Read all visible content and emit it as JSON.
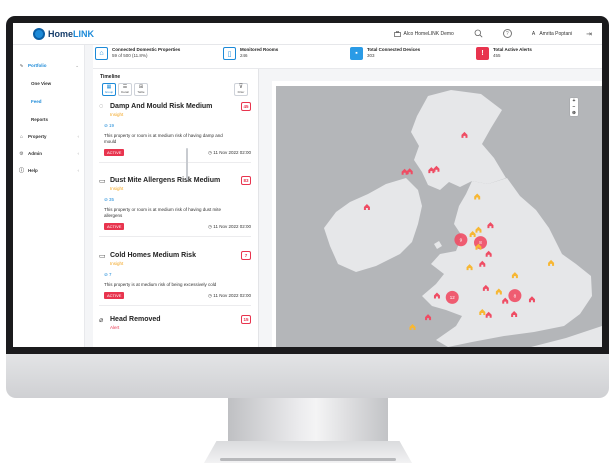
{
  "app": {
    "logo_home": "Home",
    "logo_link": "LINK",
    "demo_name": "Alco HomeLINK Demo",
    "help_glyph": "?",
    "user_initial": "A",
    "user_name": "Amrita Poptani"
  },
  "sidebar": {
    "portfolio": "Portfolio",
    "one_view": "One View",
    "feed": "Feed",
    "reports": "Reports",
    "property": "Property",
    "admin": "Admin",
    "help": "Help"
  },
  "stats": [
    {
      "title": "Connected Domestic Properties",
      "value": "59 of 500 (11.8%)",
      "color": "#1c8ad8"
    },
    {
      "title": "Monitored Rooms",
      "value": "246",
      "color": "#1c8ad8"
    },
    {
      "title": "Total Connected Devices",
      "value": "303",
      "color": "#2a9be6"
    },
    {
      "title": "Total Active Alerts",
      "value": "455",
      "color": "#e8344e"
    }
  ],
  "timeline": {
    "title": "Timeline",
    "views": [
      "Group",
      "Detail",
      "Table"
    ],
    "filter_label": "Filter",
    "cards": [
      {
        "title": "Damp And Mould Risk Medium",
        "type": "Insight",
        "count": "45",
        "link": "19",
        "desc": "This property or room is at medium risk of having damp and mould",
        "status": "ACTIVE",
        "date": "11 Nov 2022 02:00"
      },
      {
        "title": "Dust Mite Allergens Risk Medium",
        "type": "Insight",
        "count": "83",
        "link": "35",
        "desc": "This property or room is at medium risk of having dust mite allergens",
        "status": "ACTIVE",
        "date": "11 Nov 2022 02:00"
      },
      {
        "title": "Cold Homes Medium Risk",
        "type": "Insight",
        "count": "7",
        "link": "7",
        "desc": "This property is at medium risk of being excessively cold",
        "status": "ACTIVE",
        "date": "11 Nov 2022 02:00"
      },
      {
        "title": "Head Removed",
        "type": "Alert",
        "count": "15"
      }
    ]
  },
  "map": {
    "zoom_in": "+",
    "zoom_out": "−",
    "reset": "⊕",
    "colors": {
      "land": "#e6e7e9",
      "sea": "#b4b6b9",
      "red_marker": "#ef4d64",
      "amber_marker": "#f7b733"
    },
    "markers": [
      {
        "kind": "red",
        "lon": -2.1,
        "lat": 57.14
      },
      {
        "kind": "red",
        "lon": -3.2,
        "lat": 55.95
      },
      {
        "kind": "red",
        "lon": -3.4,
        "lat": 55.9
      },
      {
        "kind": "red",
        "lon": -4.25,
        "lat": 55.86
      },
      {
        "kind": "red",
        "lon": -4.45,
        "lat": 55.84
      },
      {
        "kind": "red",
        "lon": -5.93,
        "lat": 54.6
      },
      {
        "kind": "amber",
        "lon": -1.6,
        "lat": 54.97
      },
      {
        "kind": "amber",
        "lon": -1.55,
        "lat": 53.8
      },
      {
        "kind": "amber",
        "lon": -1.78,
        "lat": 53.65
      },
      {
        "kind": "red",
        "lon": -1.08,
        "lat": 53.96
      },
      {
        "kind": "cluster",
        "lon": -2.24,
        "lat": 53.48
      },
      {
        "kind": "cluster",
        "lon": -1.47,
        "lat": 53.38
      },
      {
        "kind": "amber",
        "lon": -1.55,
        "lat": 53.2
      },
      {
        "kind": "red",
        "lon": -1.15,
        "lat": 52.95
      },
      {
        "kind": "red",
        "lon": -1.4,
        "lat": 52.6
      },
      {
        "kind": "amber",
        "lon": -1.9,
        "lat": 52.48
      },
      {
        "kind": "amber",
        "lon": 1.3,
        "lat": 52.63
      },
      {
        "kind": "amber",
        "lon": -0.12,
        "lat": 52.2
      },
      {
        "kind": "red",
        "lon": -1.26,
        "lat": 51.75
      },
      {
        "kind": "amber",
        "lon": -0.75,
        "lat": 51.62
      },
      {
        "kind": "cluster",
        "lon": -2.58,
        "lat": 51.45
      },
      {
        "kind": "red",
        "lon": -3.18,
        "lat": 51.48
      },
      {
        "kind": "cluster",
        "lon": -0.12,
        "lat": 51.51
      },
      {
        "kind": "red",
        "lon": 0.55,
        "lat": 51.35
      },
      {
        "kind": "red",
        "lon": -0.5,
        "lat": 51.3
      },
      {
        "kind": "amber",
        "lon": -1.4,
        "lat": 50.9
      },
      {
        "kind": "red",
        "lon": -0.15,
        "lat": 50.83
      },
      {
        "kind": "red",
        "lon": -1.15,
        "lat": 50.8
      },
      {
        "kind": "amber",
        "lon": -4.14,
        "lat": 50.37
      },
      {
        "kind": "red",
        "lon": -3.53,
        "lat": 50.72
      }
    ],
    "cluster_counts": {
      "manchester": "9",
      "sheffield": "8",
      "bristol": "12",
      "london": "8"
    }
  }
}
